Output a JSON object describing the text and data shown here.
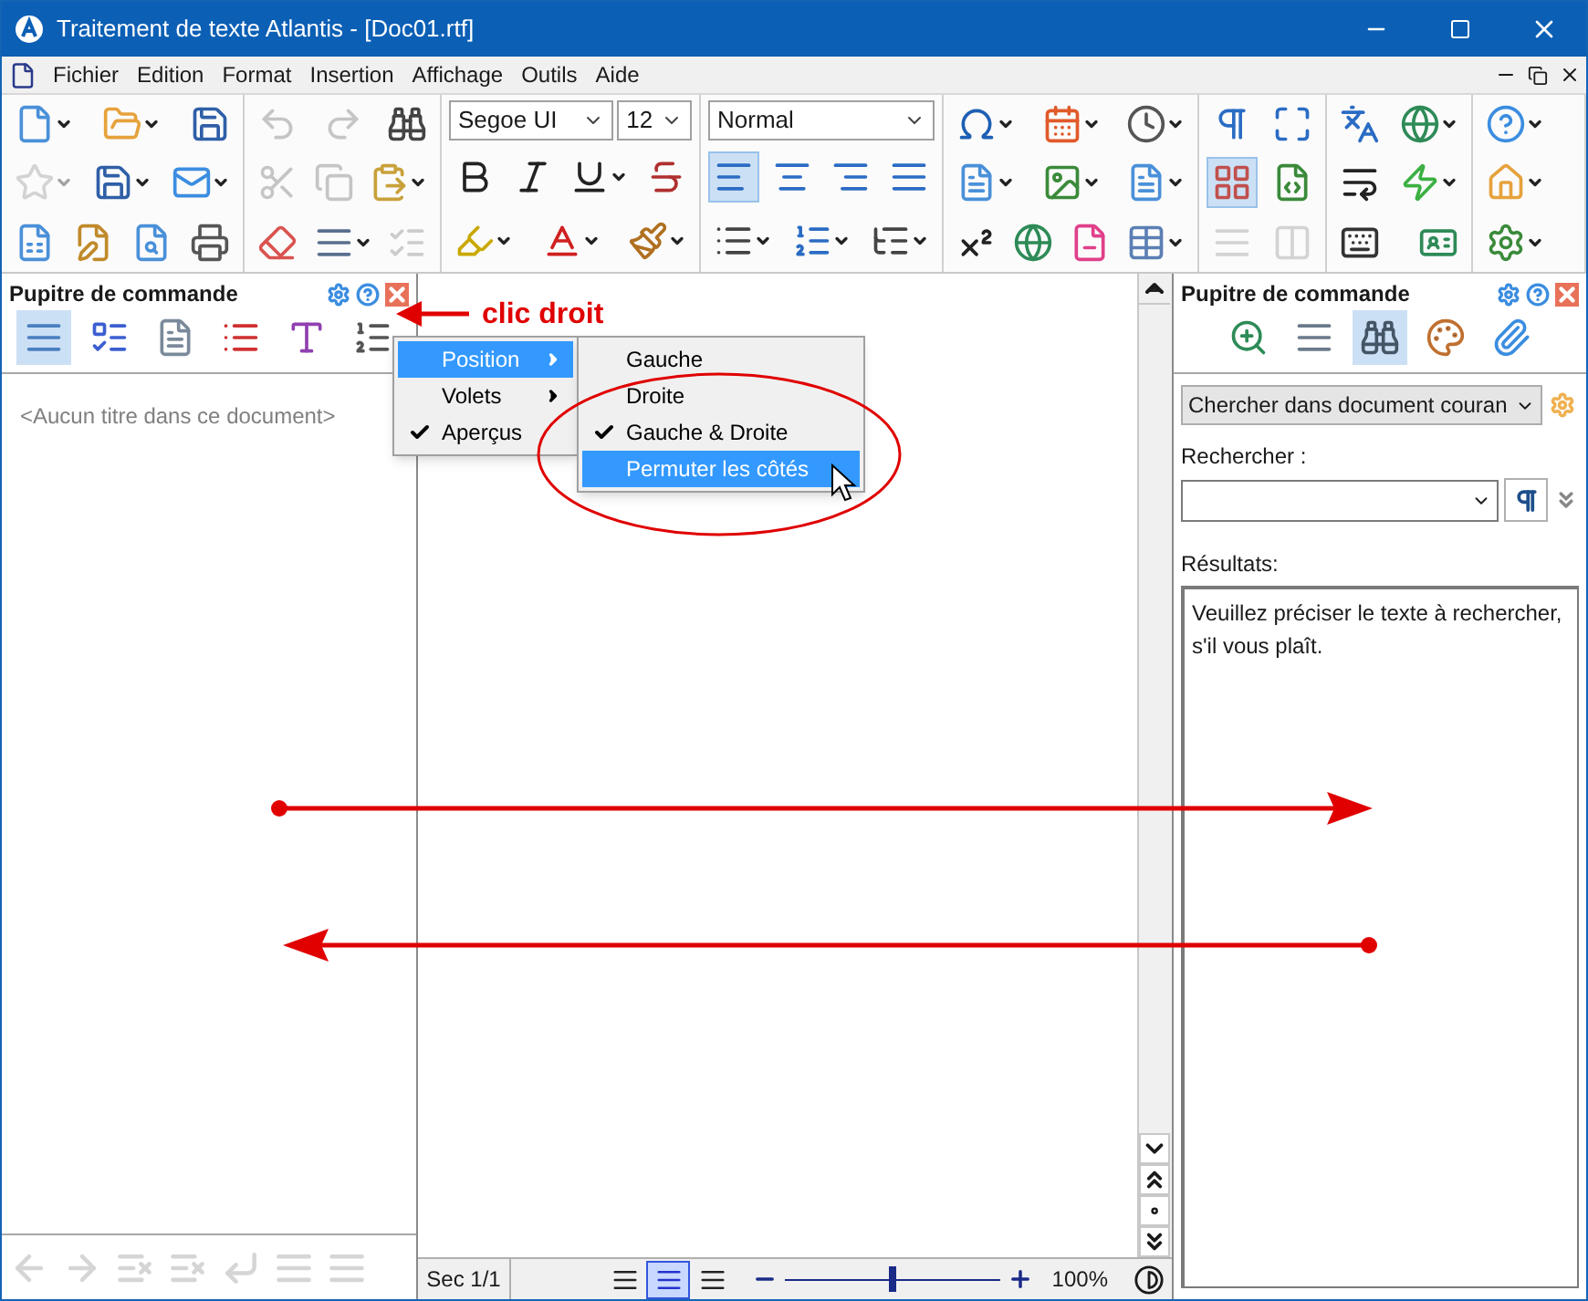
{
  "window": {
    "title": "Traitement de texte Atlantis - [Doc01.rtf]"
  },
  "menu": [
    "Fichier",
    "Edition",
    "Format",
    "Insertion",
    "Affichage",
    "Outils",
    "Aide"
  ],
  "toolbar": {
    "groups": [
      {
        "rows": [
          [
            {
              "kind": "button",
              "menu": true,
              "disabled": false,
              "selected": false
            },
            {
              "kind": "button",
              "menu": true,
              "disabled": false,
              "selected": false
            },
            {
              "kind": "button",
              "menu": false,
              "disabled": false,
              "selected": false
            }
          ],
          [
            {
              "kind": "button",
              "menu": true,
              "disabled": true,
              "selected": false
            },
            {
              "kind": "button",
              "menu": true,
              "disabled": false,
              "selected": false
            },
            {
              "kind": "button",
              "menu": true,
              "disabled": false,
              "selected": false
            }
          ],
          [
            {
              "kind": "button",
              "menu": false,
              "disabled": false,
              "selected": false
            },
            {
              "kind": "button",
              "menu": false,
              "disabled": false,
              "selected": false
            },
            {
              "kind": "button",
              "menu": false,
              "disabled": false,
              "selected": false
            },
            {
              "kind": "button",
              "menu": false,
              "disabled": false,
              "selected": false
            }
          ]
        ]
      },
      {
        "rows": [
          [
            {
              "kind": "button",
              "menu": false,
              "disabled": true,
              "selected": false
            },
            {
              "kind": "button",
              "menu": false,
              "disabled": true,
              "selected": false
            },
            {
              "kind": "button",
              "menu": false,
              "disabled": false,
              "selected": false
            }
          ],
          [
            {
              "kind": "button",
              "menu": false,
              "disabled": true,
              "selected": false
            },
            {
              "kind": "button",
              "menu": false,
              "disabled": true,
              "selected": false
            },
            {
              "kind": "button",
              "menu": true,
              "disabled": false,
              "selected": false
            }
          ],
          [
            {
              "kind": "button",
              "menu": false,
              "disabled": false,
              "selected": false
            },
            {
              "kind": "button",
              "menu": true,
              "disabled": false,
              "selected": false
            },
            {
              "kind": "button",
              "menu": false,
              "disabled": true,
              "selected": false
            }
          ]
        ]
      },
      {
        "rows": [
          [
            {
              "kind": "combo",
              "value": "Segoe UI"
            },
            {
              "kind": "combo",
              "value": "12"
            }
          ],
          [
            {
              "kind": "button",
              "menu": false,
              "disabled": false,
              "selected": false
            },
            {
              "kind": "button",
              "menu": false,
              "disabled": false,
              "selected": false
            },
            {
              "kind": "button",
              "menu": true,
              "disabled": false,
              "selected": false
            },
            {
              "kind": "button",
              "menu": false,
              "disabled": false,
              "selected": false
            }
          ],
          [
            {
              "kind": "button",
              "menu": true,
              "disabled": false,
              "selected": false
            },
            {
              "kind": "button",
              "menu": true,
              "disabled": false,
              "selected": false
            },
            {
              "kind": "button",
              "menu": true,
              "disabled": false,
              "selected": false
            }
          ]
        ]
      },
      {
        "rows": [
          [
            {
              "kind": "combo",
              "value": "Normal"
            }
          ],
          [
            {
              "kind": "button",
              "menu": false,
              "disabled": false,
              "selected": true
            },
            {
              "kind": "button",
              "menu": false,
              "disabled": false,
              "selected": false
            },
            {
              "kind": "button",
              "menu": false,
              "disabled": false,
              "selected": false
            },
            {
              "kind": "button",
              "menu": false,
              "disabled": false,
              "selected": false
            }
          ],
          [
            {
              "kind": "button",
              "menu": true,
              "disabled": false,
              "selected": false
            },
            {
              "kind": "button",
              "menu": true,
              "disabled": false,
              "selected": false
            },
            {
              "kind": "button",
              "menu": true,
              "disabled": false,
              "selected": false
            }
          ]
        ]
      },
      {
        "rows": [
          [
            {
              "kind": "button",
              "menu": true,
              "disabled": false,
              "selected": false
            },
            {
              "kind": "button",
              "menu": true,
              "disabled": false,
              "selected": false
            },
            {
              "kind": "button",
              "menu": true,
              "disabled": false,
              "selected": false
            }
          ],
          [
            {
              "kind": "button",
              "menu": true,
              "disabled": false,
              "selected": false
            },
            {
              "kind": "button",
              "menu": true,
              "disabled": false,
              "selected": false
            },
            {
              "kind": "button",
              "menu": true,
              "disabled": false,
              "selected": false
            }
          ],
          [
            {
              "kind": "button",
              "menu": false,
              "disabled": false,
              "selected": false
            },
            {
              "kind": "button",
              "menu": false,
              "disabled": false,
              "selected": false
            },
            {
              "kind": "button",
              "menu": false,
              "disabled": false,
              "selected": false
            },
            {
              "kind": "button",
              "menu": true,
              "disabled": false,
              "selected": false
            }
          ]
        ]
      },
      {
        "rows": [
          [
            {
              "kind": "button",
              "menu": false,
              "disabled": false,
              "selected": false
            },
            {
              "kind": "button",
              "menu": false,
              "disabled": false,
              "selected": false
            }
          ],
          [
            {
              "kind": "button",
              "menu": false,
              "disabled": false,
              "selected": true
            },
            {
              "kind": "button",
              "menu": false,
              "disabled": false,
              "selected": false
            }
          ],
          [
            {
              "kind": "button",
              "menu": false,
              "disabled": true,
              "selected": false
            },
            {
              "kind": "button",
              "menu": false,
              "disabled": true,
              "selected": false
            }
          ]
        ]
      },
      {
        "rows": [
          [
            {
              "kind": "button",
              "menu": false,
              "disabled": false,
              "selected": false
            },
            {
              "kind": "button",
              "menu": true,
              "disabled": false,
              "selected": false
            }
          ],
          [
            {
              "kind": "button",
              "menu": false,
              "disabled": false,
              "selected": false
            },
            {
              "kind": "button",
              "menu": true,
              "disabled": false,
              "selected": false
            }
          ],
          [
            {
              "kind": "button",
              "menu": false,
              "disabled": false,
              "selected": false
            },
            {
              "kind": "button",
              "menu": false,
              "disabled": false,
              "selected": false
            }
          ]
        ]
      },
      {
        "rows": [
          [
            {
              "kind": "button",
              "menu": true,
              "disabled": false,
              "selected": false
            }
          ],
          [
            {
              "kind": "button",
              "menu": true,
              "disabled": false,
              "selected": false
            }
          ],
          [
            {
              "kind": "button",
              "menu": true,
              "disabled": false,
              "selected": false
            }
          ]
        ]
      }
    ]
  },
  "left_panel": {
    "title": "Pupitre de commande",
    "tabs": [
      {
        "selected": true
      },
      {
        "selected": false
      },
      {
        "selected": false
      },
      {
        "selected": false
      },
      {
        "selected": false
      },
      {
        "selected": false
      }
    ],
    "empty_text": "<Aucun titre dans ce document>",
    "bottom_buttons": [
      {
        "disabled": true
      },
      {
        "disabled": true
      },
      {
        "disabled": true
      },
      {
        "disabled": true
      },
      {
        "disabled": true
      },
      {
        "disabled": true
      },
      {
        "disabled": true
      }
    ]
  },
  "context_menu": {
    "items": [
      {
        "label": "Position",
        "selected": true,
        "checked": false,
        "submenu": true
      },
      {
        "label": "Volets",
        "selected": false,
        "checked": false,
        "submenu": true
      },
      {
        "label": "Aperçus",
        "selected": false,
        "checked": true,
        "submenu": false
      }
    ]
  },
  "submenu": {
    "items": [
      {
        "label": "Gauche",
        "selected": false,
        "checked": false
      },
      {
        "label": "Droite",
        "selected": false,
        "checked": false
      },
      {
        "label": "Gauche & Droite",
        "selected": false,
        "checked": true
      },
      {
        "label": "Permuter les côtés",
        "selected": true,
        "checked": false
      }
    ]
  },
  "annotation": {
    "label": "clic droit"
  },
  "right_panel": {
    "title": "Pupitre de commande",
    "tabs": [
      {
        "selected": false
      },
      {
        "selected": false
      },
      {
        "selected": true
      },
      {
        "selected": false
      },
      {
        "selected": false
      }
    ],
    "scope": "Chercher dans document couran",
    "search_label": "Rechercher :",
    "results_label": "Résultats:",
    "results_text": "Veuillez préciser le texte à rechercher, s'il vous plaît."
  },
  "status_bar": {
    "section": "Sec 1/1",
    "views": [
      {
        "selected": false
      },
      {
        "selected": true
      },
      {
        "selected": false
      }
    ],
    "zoom": {
      "level": 0.5
    },
    "zoom_reading": "100%"
  }
}
